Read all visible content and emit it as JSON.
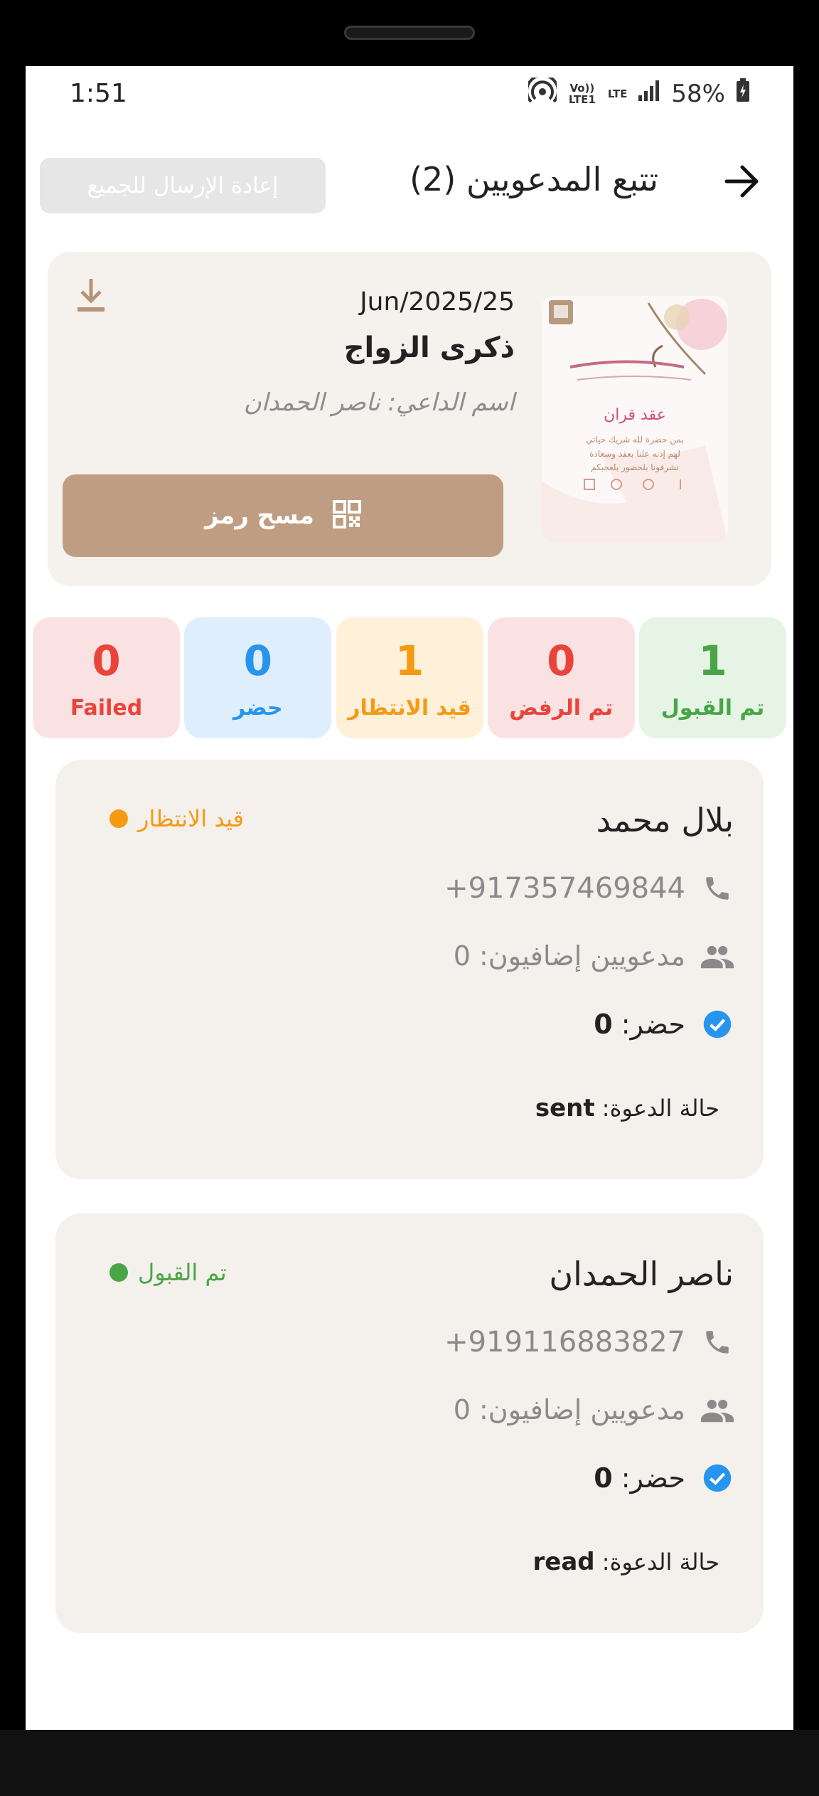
{
  "status_bar": {
    "time": "1:51",
    "volte_label": "Vo)) LTE1",
    "lte_label": "LTE",
    "battery": "58%"
  },
  "header": {
    "title": "تتبع المدعويين (2)",
    "resend_all_label": "إعادة الإرسال للجميع",
    "back_icon": "arrow-right-icon"
  },
  "event": {
    "date": "Jun/2025/25",
    "title": "ذكرى الزواج",
    "host": "اسم الداعي: ناصر الحمدان",
    "scan_label": "مسح رمز",
    "invite_image": {
      "heading": "عقد قران",
      "line1": "بمن حضرة لله شريك حياتي",
      "line2": "لهم إذنه علنا بعقد وسعادة",
      "line3": "تشرفونا بلحضور بلعجبكم"
    }
  },
  "stats": [
    {
      "label": "تم القبول",
      "value": "1",
      "color": "#49a546"
    },
    {
      "label": "تم الرفض",
      "value": "0",
      "color": "#e9443b"
    },
    {
      "label": "قيد الانتظار",
      "value": "1",
      "color": "#f49a13"
    },
    {
      "label": "حضر",
      "value": "0",
      "color": "#2795ee"
    },
    {
      "label": "Failed",
      "value": "0",
      "color": "#e9443b"
    }
  ],
  "guests": [
    {
      "name": "بلال محمد",
      "status": "قيد الانتظار",
      "status_color": "#f49a13",
      "phone": "+917357469844",
      "extra": "مدعويين إضافيون: 0",
      "attend_label": "حضر:",
      "attend_value": "0",
      "invite_label": "حالة الدعوة:",
      "invite_value": "sent"
    },
    {
      "name": "ناصر الحمدان",
      "status": "تم القبول",
      "status_color": "#49a546",
      "phone": "+919116883827",
      "extra": "مدعويين إضافيون: 0",
      "attend_label": "حضر:",
      "attend_value": "0",
      "invite_label": "حالة الدعوة:",
      "invite_value": "read"
    }
  ]
}
